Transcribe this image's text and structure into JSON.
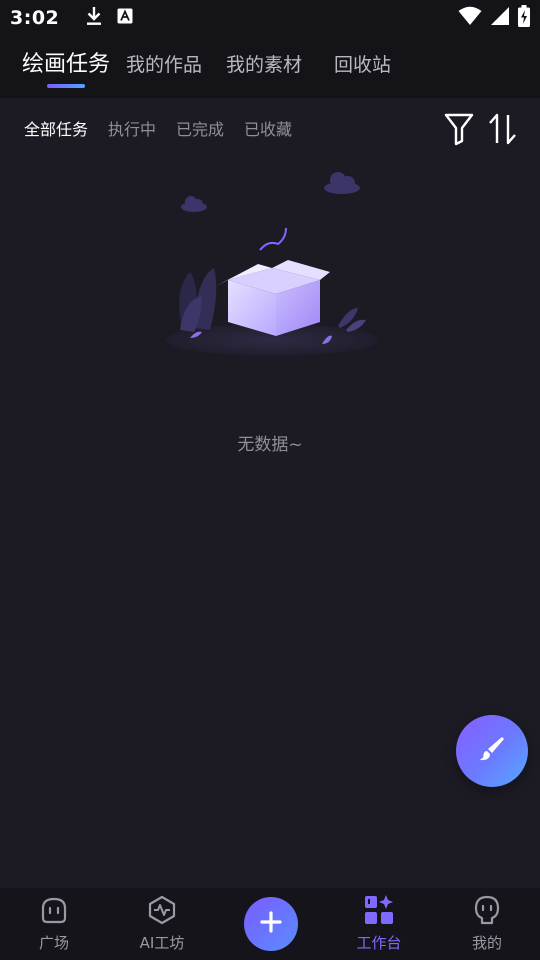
{
  "status_bar": {
    "time": "3:02",
    "icons": [
      "download-icon",
      "text-a-icon",
      "wifi-icon",
      "signal-icon",
      "battery-icon"
    ]
  },
  "top_tabs": [
    {
      "label": "绘画任务",
      "active": true
    },
    {
      "label": "我的作品",
      "active": false
    },
    {
      "label": "我的素材",
      "active": false
    },
    {
      "label": "回收站",
      "active": false
    }
  ],
  "filters": [
    {
      "label": "全部任务",
      "active": true
    },
    {
      "label": "执行中",
      "active": false
    },
    {
      "label": "已完成",
      "active": false
    },
    {
      "label": "已收藏",
      "active": false
    }
  ],
  "empty_state": {
    "text": "无数据~"
  },
  "bottom_nav": [
    {
      "label": "广场",
      "icon": "robot-face-icon",
      "active": false
    },
    {
      "label": "AI工坊",
      "icon": "pulse-hexagon-icon",
      "active": false
    },
    {
      "label": "",
      "icon": "plus-icon",
      "active": false
    },
    {
      "label": "工作台",
      "icon": "workbench-grid-icon",
      "active": true
    },
    {
      "label": "我的",
      "icon": "profile-face-icon",
      "active": false
    }
  ],
  "colors": {
    "background": "#1c1b24",
    "header_bg": "#141318",
    "accent": "#7d6bff",
    "muted_text": "#8f8e99"
  }
}
